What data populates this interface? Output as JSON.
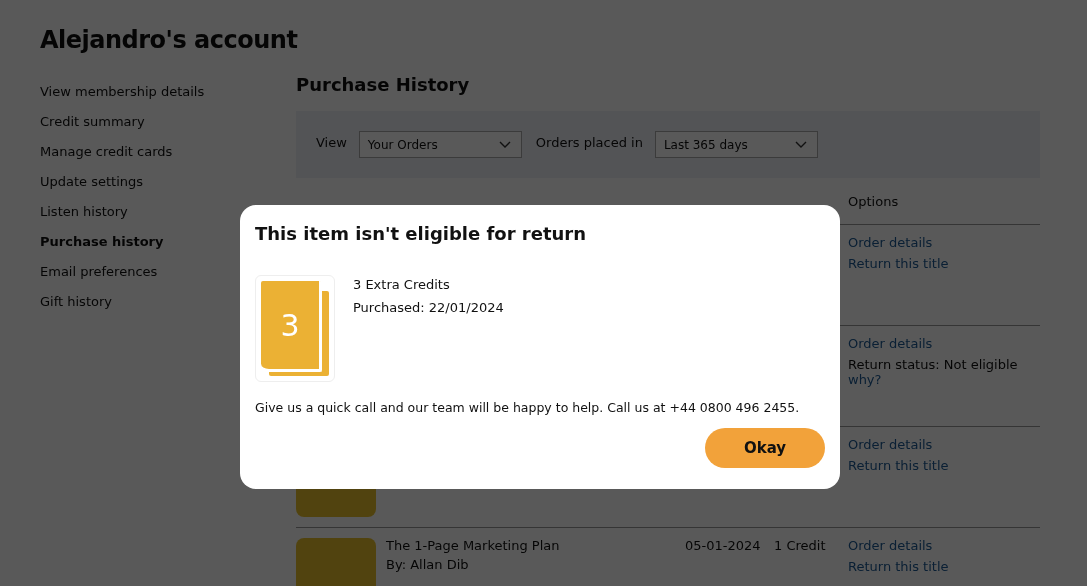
{
  "page_title": "Alejandro's account",
  "sidebar": {
    "items": [
      {
        "label": "View membership details",
        "selected": false
      },
      {
        "label": "Credit summary",
        "selected": false
      },
      {
        "label": "Manage credit cards",
        "selected": false
      },
      {
        "label": "Update settings",
        "selected": false
      },
      {
        "label": "Listen history",
        "selected": false
      },
      {
        "label": "Purchase history",
        "selected": true
      },
      {
        "label": "Email preferences",
        "selected": false
      },
      {
        "label": "Gift history",
        "selected": false
      }
    ]
  },
  "main": {
    "heading": "Purchase History",
    "filters": [
      {
        "label": "View",
        "value": "Your Orders"
      },
      {
        "label": "Orders placed in",
        "value": "Last 365 days"
      }
    ],
    "table": {
      "column_options": "Options",
      "rows": [
        {
          "options": [
            {
              "kind": "link",
              "text": "Order details"
            },
            {
              "kind": "link",
              "text": "Return this title"
            }
          ]
        },
        {
          "options": [
            {
              "kind": "link",
              "text": "Order details"
            },
            {
              "kind": "text",
              "text": "Return status: Not eligible"
            },
            {
              "kind": "link",
              "text": "why?"
            }
          ]
        },
        {
          "cover": true,
          "options": [
            {
              "kind": "link",
              "text": "Order details"
            },
            {
              "kind": "link",
              "text": "Return this title"
            }
          ]
        },
        {
          "cover": true,
          "title": "The 1-Page Marketing Plan",
          "author": "By: Allan Dib",
          "date": "05-01-2024",
          "price": "1 Credit",
          "options": [
            {
              "kind": "link",
              "text": "Order details"
            },
            {
              "kind": "link",
              "text": "Return this title"
            }
          ]
        }
      ]
    }
  },
  "dialog": {
    "title": "This item isn't eligible for return",
    "item": {
      "badge": "3",
      "name": "3 Extra Credits",
      "purchased": "Purchased: 22/01/2024"
    },
    "message": "Give us a quick call and our team will be happy to help. Call us at +44 0800 496 2455.",
    "button": "Okay"
  }
}
